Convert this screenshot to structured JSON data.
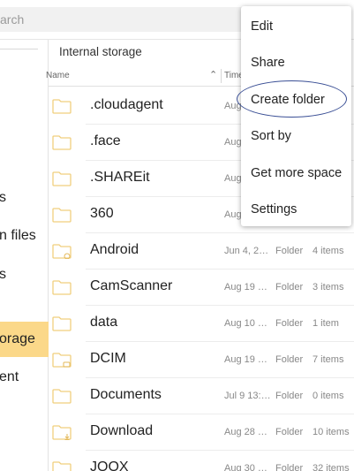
{
  "search": {
    "placeholder": "arch"
  },
  "sidebar": {
    "items": [
      {
        "label": "s",
        "active": false
      },
      {
        "label": "n files",
        "active": false
      },
      {
        "label": "s",
        "active": false
      },
      {
        "label": "orage",
        "active": true
      },
      {
        "label": "ent",
        "active": false
      }
    ]
  },
  "main": {
    "breadcrumb": "Internal storage",
    "columns": {
      "name": "Name",
      "time": "Time"
    },
    "rows": [
      {
        "name": ".cloudagent",
        "date": "Aug",
        "kind": "",
        "items": "",
        "badge": ""
      },
      {
        "name": ".face",
        "date": "Aug",
        "kind": "",
        "items": "",
        "badge": ""
      },
      {
        "name": ".SHAREit",
        "date": "Aug",
        "kind": "",
        "items": "",
        "badge": ""
      },
      {
        "name": "360",
        "date": "Aug",
        "kind": "",
        "items": "",
        "badge": ""
      },
      {
        "name": "Android",
        "date": "Jun 4, 2…",
        "kind": "Folder",
        "items": "4 items",
        "badge": "gear"
      },
      {
        "name": "CamScanner",
        "date": "Aug 19 …",
        "kind": "Folder",
        "items": "3 items",
        "badge": ""
      },
      {
        "name": "data",
        "date": "Aug 10 …",
        "kind": "Folder",
        "items": "1 item",
        "badge": ""
      },
      {
        "name": "DCIM",
        "date": "Aug 19 …",
        "kind": "Folder",
        "items": "7 items",
        "badge": "camera"
      },
      {
        "name": "Documents",
        "date": "Jul 9 13:…",
        "kind": "Folder",
        "items": "0 items",
        "badge": ""
      },
      {
        "name": "Download",
        "date": "Aug 28 …",
        "kind": "Folder",
        "items": "10 items",
        "badge": "download"
      },
      {
        "name": "JOOX",
        "date": "Aug 30 …",
        "kind": "Folder",
        "items": "32 items",
        "badge": ""
      }
    ]
  },
  "menu": {
    "items": [
      "Edit",
      "Share",
      "Create folder",
      "Sort by",
      "Get more space",
      "Settings"
    ],
    "highlighted": "Create folder"
  },
  "colors": {
    "folder": "#f7d88a",
    "accent": "#fbd889",
    "highlight_ring": "#3a4f95"
  }
}
